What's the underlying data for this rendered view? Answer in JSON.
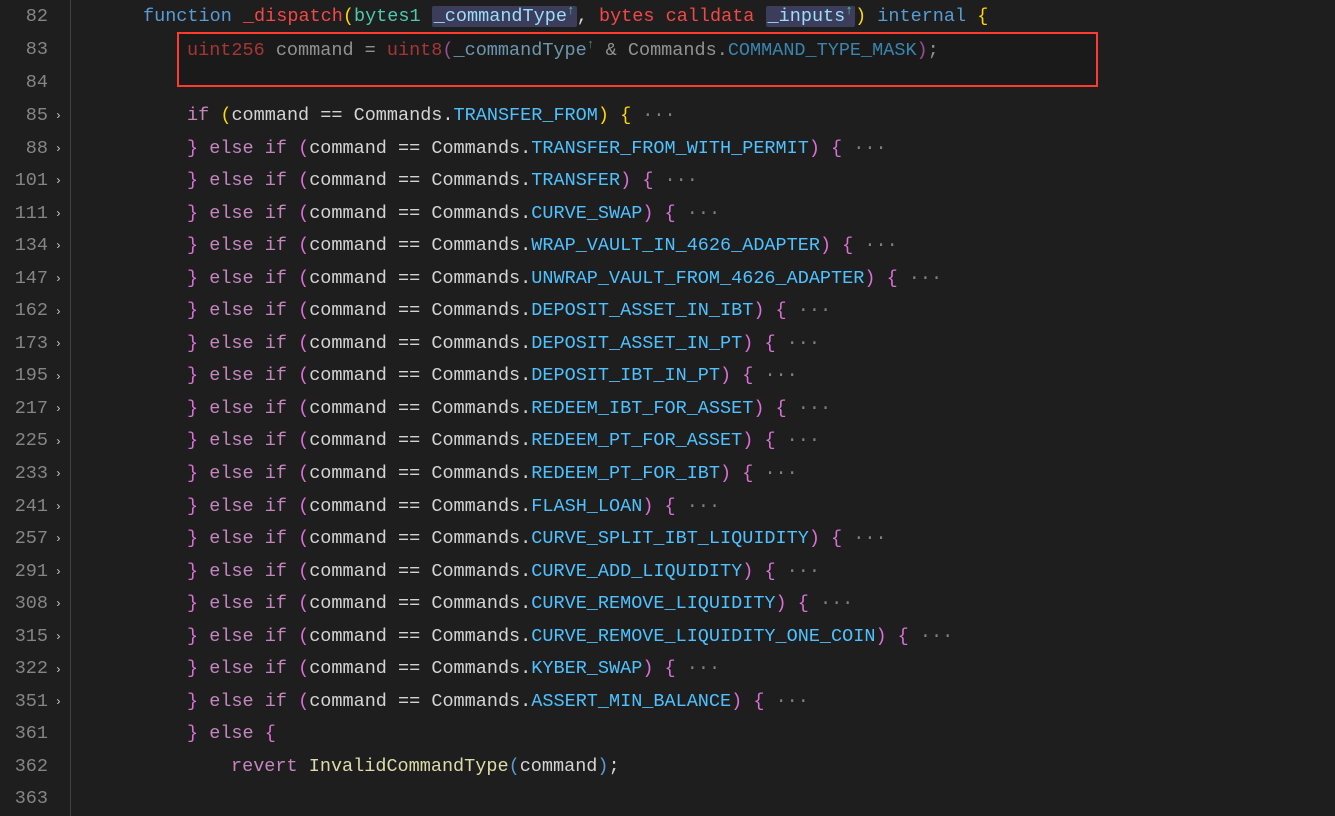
{
  "signature": {
    "line": "82",
    "kw_function": "function",
    "fn_name": "_dispatch",
    "type_bytes1": "bytes1",
    "param_cmdType": "_commandType",
    "kw_bytes": "bytes",
    "kw_calldata": "calldata",
    "param_inputs": "_inputs",
    "kw_internal": "internal",
    "brace_open": "{"
  },
  "decl": {
    "line": "83",
    "type_uint256": "uint256",
    "var_command": "command",
    "eq": "=",
    "cast_uint8": "uint8",
    "param_ref": "_commandType",
    "amp": "&",
    "ns": "Commands",
    "dot": ".",
    "mask": "COMMAND_TYPE_MASK",
    "semi": ";"
  },
  "blank": {
    "line": "84"
  },
  "first_if": {
    "line": "85",
    "kw_if": "if",
    "var_command": "command",
    "ns": "Commands",
    "dot": ".",
    "enum": "TRANSFER_FROM"
  },
  "branches": [
    {
      "line": "88",
      "enum": "TRANSFER_FROM_WITH_PERMIT"
    },
    {
      "line": "101",
      "enum": "TRANSFER"
    },
    {
      "line": "111",
      "enum": "CURVE_SWAP"
    },
    {
      "line": "134",
      "enum": "WRAP_VAULT_IN_4626_ADAPTER"
    },
    {
      "line": "147",
      "enum": "UNWRAP_VAULT_FROM_4626_ADAPTER"
    },
    {
      "line": "162",
      "enum": "DEPOSIT_ASSET_IN_IBT"
    },
    {
      "line": "173",
      "enum": "DEPOSIT_ASSET_IN_PT"
    },
    {
      "line": "195",
      "enum": "DEPOSIT_IBT_IN_PT"
    },
    {
      "line": "217",
      "enum": "REDEEM_IBT_FOR_ASSET"
    },
    {
      "line": "225",
      "enum": "REDEEM_PT_FOR_ASSET"
    },
    {
      "line": "233",
      "enum": "REDEEM_PT_FOR_IBT"
    },
    {
      "line": "241",
      "enum": "FLASH_LOAN"
    },
    {
      "line": "257",
      "enum": "CURVE_SPLIT_IBT_LIQUIDITY"
    },
    {
      "line": "291",
      "enum": "CURVE_ADD_LIQUIDITY"
    },
    {
      "line": "308",
      "enum": "CURVE_REMOVE_LIQUIDITY"
    },
    {
      "line": "315",
      "enum": "CURVE_REMOVE_LIQUIDITY_ONE_COIN"
    },
    {
      "line": "322",
      "enum": "KYBER_SWAP"
    },
    {
      "line": "351",
      "enum": "ASSERT_MIN_BALANCE"
    }
  ],
  "else_block": {
    "line_else": "361",
    "kw_else": "else",
    "line_revert": "362",
    "kw_revert": "revert",
    "err_name": "InvalidCommandType",
    "var_command": "command",
    "line_end": "363"
  },
  "shared": {
    "kw_else": "else",
    "kw_if": "if",
    "eqop": "==",
    "ns": "Commands",
    "dot": ".",
    "dots": "···",
    "open": "{",
    "close": "}",
    "lparen": "(",
    "rparen": ")",
    "lparen2": "(",
    "rparen2": ")"
  }
}
